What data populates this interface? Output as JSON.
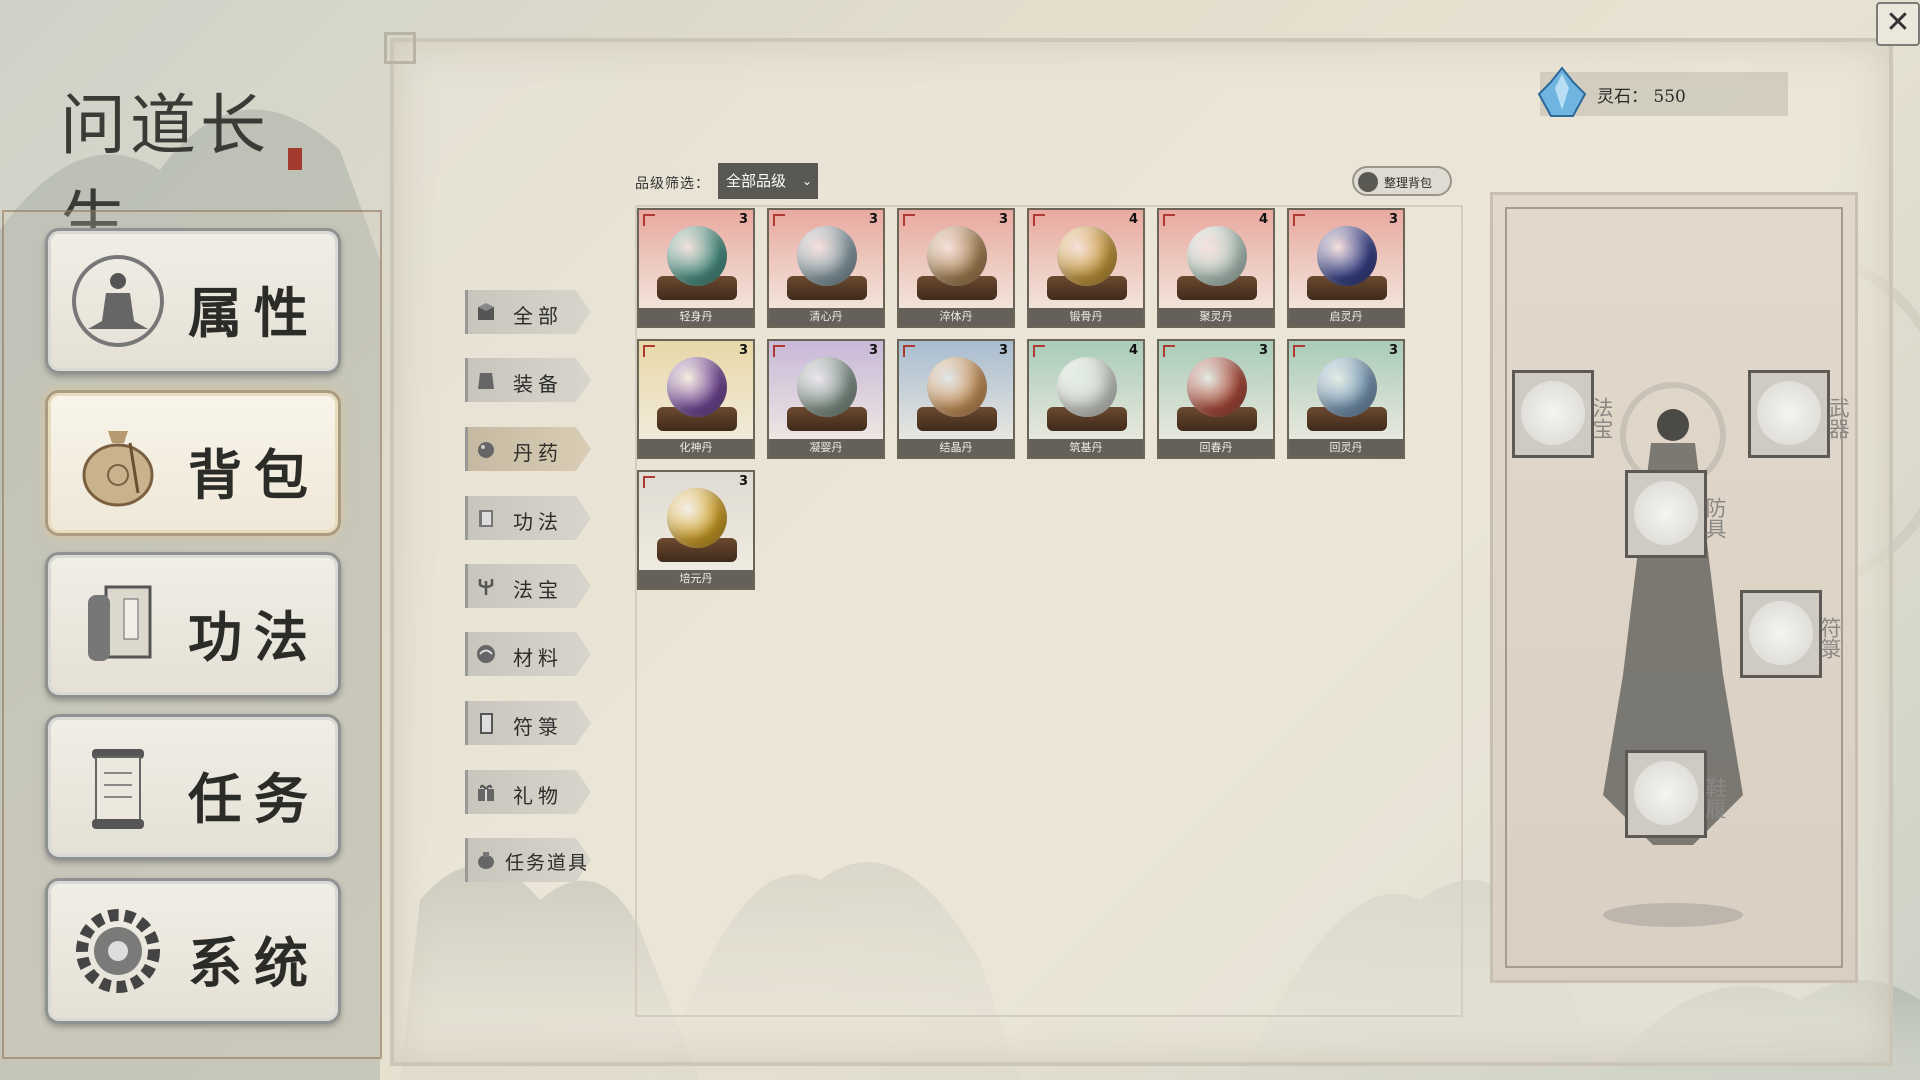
{
  "logo": {
    "title": "问道长生"
  },
  "nav": [
    {
      "key": "attributes",
      "label": "属性",
      "icon": "meditating-figure-icon"
    },
    {
      "key": "bag",
      "label": "背包",
      "icon": "pouch-icon"
    },
    {
      "key": "techniques",
      "label": "功法",
      "icon": "scroll-book-icon"
    },
    {
      "key": "quests",
      "label": "任务",
      "icon": "quest-scroll-icon"
    },
    {
      "key": "system",
      "label": "系统",
      "icon": "gear-icon"
    }
  ],
  "spirit_stones": {
    "label": "灵石：",
    "value": "550"
  },
  "categories": [
    {
      "label": "全部",
      "icon": "box-icon"
    },
    {
      "label": "装备",
      "icon": "armor-icon"
    },
    {
      "label": "丹药",
      "icon": "pill-icon",
      "active": true
    },
    {
      "label": "功法",
      "icon": "book-icon"
    },
    {
      "label": "法宝",
      "icon": "trident-icon"
    },
    {
      "label": "材料",
      "icon": "material-icon"
    },
    {
      "label": "符箓",
      "icon": "talisman-icon"
    },
    {
      "label": "礼物",
      "icon": "gift-icon"
    },
    {
      "label": "任务道具",
      "icon": "bag-icon"
    }
  ],
  "filter": {
    "label": "品级筛选：",
    "selected": "全部品级"
  },
  "sort_button": "整理背包",
  "items": [
    {
      "name": "轻身丹",
      "count": "3",
      "bg": "#e9a9a0",
      "orb": "#4f9a8c"
    },
    {
      "name": "清心丹",
      "count": "3",
      "bg": "#e9a9a0",
      "orb": "#8ea4ad"
    },
    {
      "name": "淬体丹",
      "count": "3",
      "bg": "#e9a9a0",
      "orb": "#b08a5a"
    },
    {
      "name": "锻骨丹",
      "count": "4",
      "bg": "#e9a9a0",
      "orb": "#d0a040"
    },
    {
      "name": "聚灵丹",
      "count": "4",
      "bg": "#e9a9a0",
      "orb": "#bcd1c8"
    },
    {
      "name": "启灵丹",
      "count": "3",
      "bg": "#e9a9a0",
      "orb": "#3a4690"
    },
    {
      "name": "化神丹",
      "count": "3",
      "bg": "#e8d8a8",
      "orb": "#7a4ea0"
    },
    {
      "name": "凝婴丹",
      "count": "3",
      "bg": "#c9b8d8",
      "orb": "#8a9c92"
    },
    {
      "name": "结晶丹",
      "count": "3",
      "bg": "#a8bccf",
      "orb": "#d29a60"
    },
    {
      "name": "筑基丹",
      "count": "4",
      "bg": "#a9cbb8",
      "orb": "#d8dcd4"
    },
    {
      "name": "回春丹",
      "count": "3",
      "bg": "#a9cbb8",
      "orb": "#b44f3e"
    },
    {
      "name": "回灵丹",
      "count": "3",
      "bg": "#a9cbb8",
      "orb": "#7d9ebc"
    },
    {
      "name": "培元丹",
      "count": "3",
      "bg": "#dedbd2",
      "orb": "#d9a82a"
    }
  ],
  "equipment": [
    {
      "key": "treasure",
      "label": "法宝"
    },
    {
      "key": "weapon",
      "label": "武器"
    },
    {
      "key": "armor",
      "label": "防具"
    },
    {
      "key": "talisman",
      "label": "符箓"
    },
    {
      "key": "shoes",
      "label": "鞋履"
    }
  ],
  "colors": {
    "accent_red": "#a53a2e",
    "panel_bg": "#e8e2d2",
    "select_bg": "#5a5853"
  }
}
